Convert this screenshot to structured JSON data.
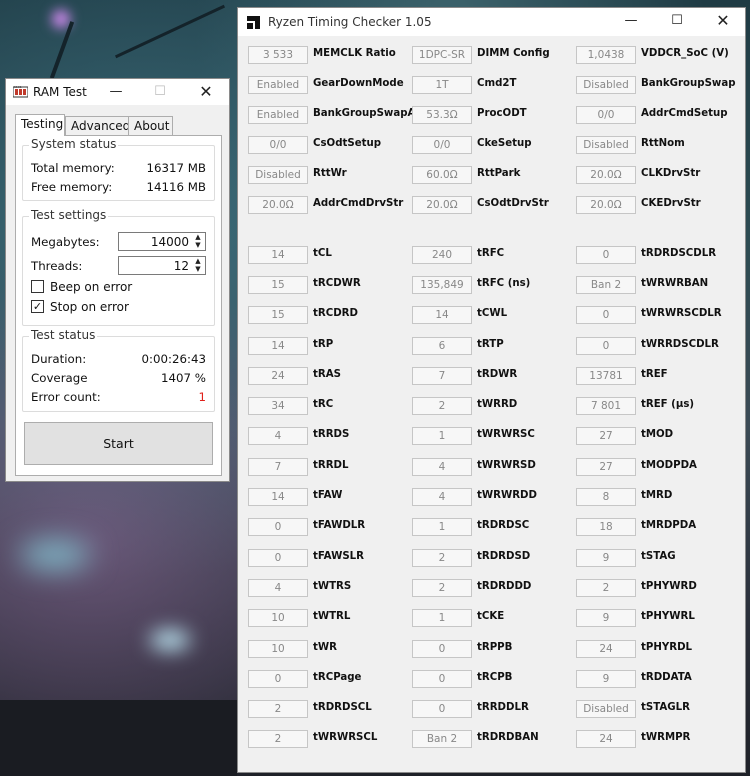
{
  "ramtest": {
    "title": "RAM Test",
    "tabs": [
      "Testing",
      "Advanced",
      "About"
    ],
    "system_status": {
      "legend": "System status",
      "total_label": "Total memory:",
      "total_value": "16317 MB",
      "free_label": "Free memory:",
      "free_value": "14116 MB"
    },
    "test_settings": {
      "legend": "Test settings",
      "megabytes_label": "Megabytes:",
      "megabytes_value": "14000",
      "threads_label": "Threads:",
      "threads_value": "12",
      "beep_label": "Beep on error",
      "beep_checked": false,
      "stop_label": "Stop on error",
      "stop_checked": true
    },
    "test_status": {
      "legend": "Test status",
      "duration_label": "Duration:",
      "duration_value": "0:00:26:43",
      "coverage_label": "Coverage",
      "coverage_value": "1407 %",
      "errors_label": "Error count:",
      "errors_value": "1",
      "error_color": "#e0201a"
    },
    "start_label": "Start"
  },
  "rtc": {
    "title": "Ryzen Timing Checker 1.05",
    "columns": [
      [
        {
          "v": "3 533",
          "n": "MEMCLK Ratio"
        },
        {
          "v": "Enabled",
          "n": "GearDownMode"
        },
        {
          "v": "Enabled",
          "n": "BankGroupSwapAlt"
        },
        {
          "v": "0/0",
          "n": "CsOdtSetup"
        },
        {
          "v": "Disabled",
          "n": "RttWr"
        },
        {
          "v": "20.0Ω",
          "n": "AddrCmdDrvStr"
        },
        null,
        {
          "v": "14",
          "n": "tCL"
        },
        {
          "v": "15",
          "n": "tRCDWR"
        },
        {
          "v": "15",
          "n": "tRCDRD"
        },
        {
          "v": "14",
          "n": "tRP"
        },
        {
          "v": "24",
          "n": "tRAS"
        },
        {
          "v": "34",
          "n": "tRC"
        },
        {
          "v": "4",
          "n": "tRRDS"
        },
        {
          "v": "7",
          "n": "tRRDL"
        },
        {
          "v": "14",
          "n": "tFAW"
        },
        {
          "v": "0",
          "n": "tFAWDLR"
        },
        {
          "v": "0",
          "n": "tFAWSLR"
        },
        {
          "v": "4",
          "n": "tWTRS"
        },
        {
          "v": "10",
          "n": "tWTRL"
        },
        {
          "v": "10",
          "n": "tWR"
        },
        {
          "v": "0",
          "n": "tRCPage"
        },
        {
          "v": "2",
          "n": "tRDRDSCL"
        },
        {
          "v": "2",
          "n": "tWRWRSCL"
        }
      ],
      [
        {
          "v": "1DPC-SR",
          "n": "DIMM Config"
        },
        {
          "v": "1T",
          "n": "Cmd2T"
        },
        {
          "v": "53.3Ω",
          "n": "ProcODT"
        },
        {
          "v": "0/0",
          "n": "CkeSetup"
        },
        {
          "v": "60.0Ω",
          "n": "RttPark"
        },
        {
          "v": "20.0Ω",
          "n": "CsOdtDrvStr"
        },
        null,
        {
          "v": "240",
          "n": "tRFC"
        },
        {
          "v": "135,849",
          "n": "tRFC (ns)"
        },
        {
          "v": "14",
          "n": "tCWL"
        },
        {
          "v": "6",
          "n": "tRTP"
        },
        {
          "v": "7",
          "n": "tRDWR"
        },
        {
          "v": "2",
          "n": "tWRRD"
        },
        {
          "v": "1",
          "n": "tWRWRSC"
        },
        {
          "v": "4",
          "n": "tWRWRSD"
        },
        {
          "v": "4",
          "n": "tWRWRDD"
        },
        {
          "v": "1",
          "n": "tRDRDSC"
        },
        {
          "v": "2",
          "n": "tRDRDSD"
        },
        {
          "v": "2",
          "n": "tRDRDDD"
        },
        {
          "v": "1",
          "n": "tCKE"
        },
        {
          "v": "0",
          "n": "tRPPB"
        },
        {
          "v": "0",
          "n": "tRCPB"
        },
        {
          "v": "0",
          "n": "tRRDDLR"
        },
        {
          "v": "Ban 2",
          "n": "tRDRDBAN"
        }
      ],
      [
        {
          "v": "1,0438",
          "n": "VDDCR_SoC (V)"
        },
        {
          "v": "Disabled",
          "n": "BankGroupSwap"
        },
        {
          "v": "0/0",
          "n": "AddrCmdSetup"
        },
        {
          "v": "Disabled",
          "n": "RttNom"
        },
        {
          "v": "20.0Ω",
          "n": "CLKDrvStr"
        },
        {
          "v": "20.0Ω",
          "n": "CKEDrvStr"
        },
        null,
        {
          "v": "0",
          "n": "tRDRDSCDLR"
        },
        {
          "v": "Ban 2",
          "n": "tWRWRBAN"
        },
        {
          "v": "0",
          "n": "tWRWRSCDLR"
        },
        {
          "v": "0",
          "n": "tWRRDSCDLR"
        },
        {
          "v": "13781",
          "n": "tREF"
        },
        {
          "v": "7 801",
          "n": "tREF (μs)"
        },
        {
          "v": "27",
          "n": "tMOD"
        },
        {
          "v": "27",
          "n": "tMODPDA"
        },
        {
          "v": "8",
          "n": "tMRD"
        },
        {
          "v": "18",
          "n": "tMRDPDA"
        },
        {
          "v": "9",
          "n": "tSTAG"
        },
        {
          "v": "2",
          "n": "tPHYWRD"
        },
        {
          "v": "9",
          "n": "tPHYWRL"
        },
        {
          "v": "24",
          "n": "tPHYRDL"
        },
        {
          "v": "9",
          "n": "tRDDATA"
        },
        {
          "v": "Disabled",
          "n": "tSTAGLR"
        },
        {
          "v": "24",
          "n": "tWRMPR"
        }
      ]
    ]
  }
}
